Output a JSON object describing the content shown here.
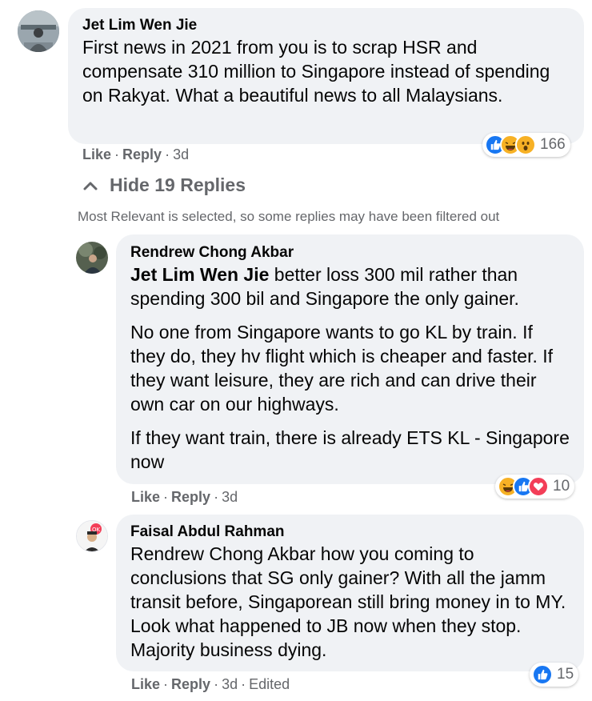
{
  "comment": {
    "author": "Jet Lim Wen Jie",
    "text": "First news in 2021 from you is to scrap HSR and compensate 310 million to Singapore instead of spending on Rakyat. What a beautiful news to all Malaysians.",
    "actions": {
      "like": "Like",
      "reply": "Reply",
      "time": "3d"
    },
    "reactions": {
      "icons": [
        "like-icon",
        "haha-icon",
        "wow-icon"
      ],
      "count": "166"
    }
  },
  "replies_toggle": {
    "label": "Hide 19 Replies",
    "notice": "Most Relevant is selected, so some replies may have been filtered out"
  },
  "replies": [
    {
      "author": "Rendrew Chong Akbar",
      "mention": "Jet Lim Wen Jie",
      "paragraphs": [
        " better loss 300 mil rather than spending 300 bil and Singapore the only gainer.",
        "No one from Singapore wants to go KL by train. If they do, they hv flight which is cheaper and faster. If they want leisure, they are rich and can drive their own car on our highways.",
        "If they want train, there is already ETS KL - Singapore now"
      ],
      "actions": {
        "like": "Like",
        "reply": "Reply",
        "time": "3d"
      },
      "reactions": {
        "icons": [
          "haha-icon",
          "like-icon",
          "love-icon"
        ],
        "count": "10"
      }
    },
    {
      "author": "Faisal Abdul Rahman",
      "text": "Rendrew Chong Akbar how you coming to conclusions that SG only gainer? With all the jamm transit before, Singaporean still bring money in to MY. Look what happened to JB now when they stop. Majority business dying.",
      "actions": {
        "like": "Like",
        "reply": "Reply",
        "time": "3d",
        "edited": "Edited"
      },
      "reactions": {
        "icons": [
          "like-icon"
        ],
        "count": "15"
      }
    }
  ],
  "colors": {
    "like": "#1877f2",
    "haha": "#f7b125",
    "love": "#f33e58",
    "bubble": "#f0f2f5",
    "muted": "#65676b"
  }
}
